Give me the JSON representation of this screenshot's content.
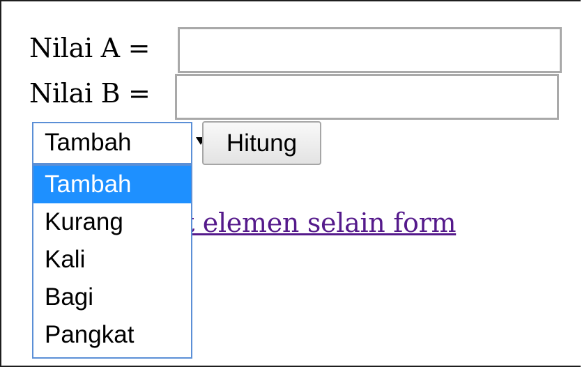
{
  "form": {
    "label_a": "Nilai A =",
    "value_a": "",
    "label_b": "Nilai B =",
    "value_b": "",
    "select": {
      "selected": "Tambah",
      "options": [
        "Tambah",
        "Kurang",
        "Kali",
        "Bagi",
        "Pangkat"
      ]
    },
    "submit_label": "Hitung",
    "link_text": "Contoh dengan objek elemen selain form",
    "link_visible_text": "t elemen selain form"
  },
  "colors": {
    "selection_highlight": "#1e90ff",
    "focus_border": "#5b8fd6",
    "link": "#551a8b"
  }
}
